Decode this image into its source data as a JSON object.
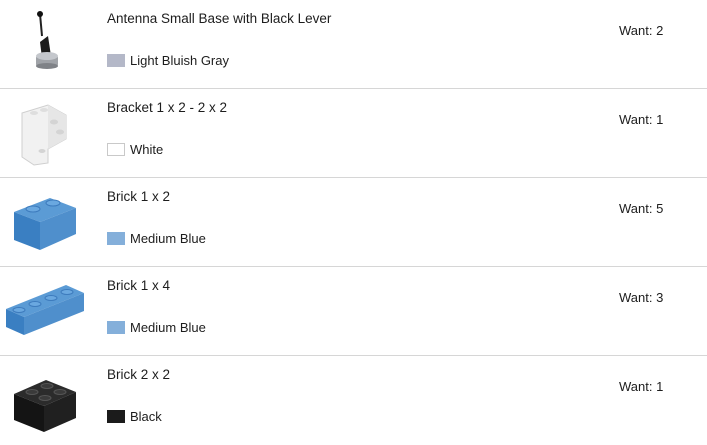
{
  "parts": [
    {
      "name": "Antenna Small Base with Black Lever",
      "color_name": "Light Bluish Gray",
      "color_hex": "#b4b8c8",
      "want_label": "Want:",
      "want_qty": "2",
      "icon": "antenna-icon"
    },
    {
      "name": "Bracket 1 x 2 - 2 x 2",
      "color_name": "White",
      "color_hex": "#ffffff",
      "want_label": "Want:",
      "want_qty": "1",
      "icon": "bracket-icon"
    },
    {
      "name": "Brick 1 x 2",
      "color_name": "Medium Blue",
      "color_hex": "#84afda",
      "want_label": "Want:",
      "want_qty": "5",
      "icon": "brick-1x2-icon"
    },
    {
      "name": "Brick 1 x 4",
      "color_name": "Medium Blue",
      "color_hex": "#84afda",
      "want_label": "Want:",
      "want_qty": "3",
      "icon": "brick-1x4-icon"
    },
    {
      "name": "Brick 2 x 2",
      "color_name": "Black",
      "color_hex": "#1b1b1b",
      "want_label": "Want:",
      "want_qty": "1",
      "icon": "brick-2x2-icon"
    }
  ]
}
